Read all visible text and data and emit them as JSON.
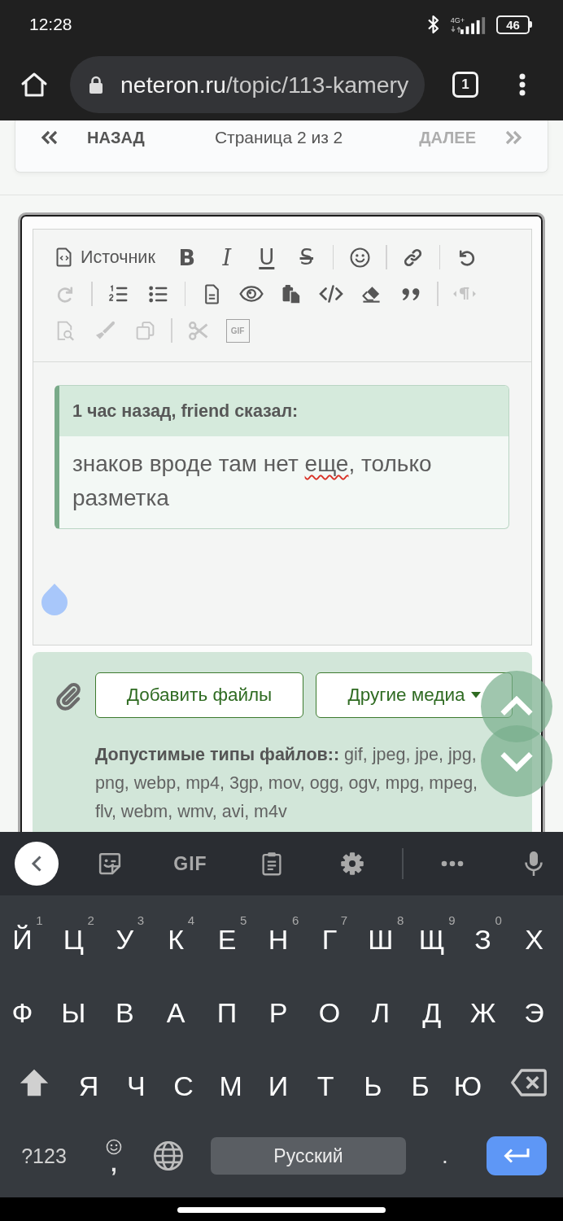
{
  "status_bar": {
    "time": "12:28",
    "network": "4G+",
    "battery": "46"
  },
  "browser": {
    "url_host": "neteron.ru",
    "url_path": "/topic/113-kamery",
    "tab_count": "1"
  },
  "pagination": {
    "prev": {
      "label": "НАЗАД",
      "disabled": false
    },
    "page": "Страница 2 из 2",
    "next": {
      "label": "ДАЛЕЕ",
      "disabled": true
    }
  },
  "editor": {
    "toolbar": [
      {
        "kind": "source",
        "label": "Источник",
        "disabled": false
      },
      {
        "kind": "bold",
        "label": "B",
        "disabled": false
      },
      {
        "kind": "italic",
        "label": "I",
        "disabled": false
      },
      {
        "kind": "underline",
        "label": "U",
        "disabled": false
      },
      {
        "kind": "strike",
        "label": "S",
        "disabled": false
      },
      {
        "kind": "separator"
      },
      {
        "kind": "emoji",
        "disabled": false
      },
      {
        "kind": "separator"
      },
      {
        "kind": "link",
        "disabled": false
      },
      {
        "kind": "separator"
      },
      {
        "kind": "undo",
        "disabled": false
      },
      {
        "kind": "redo",
        "disabled": true
      },
      {
        "kind": "separator"
      },
      {
        "kind": "numbered_list",
        "disabled": false
      },
      {
        "kind": "bullet_list",
        "disabled": false
      },
      {
        "kind": "separator"
      },
      {
        "kind": "document",
        "disabled": false
      },
      {
        "kind": "preview",
        "disabled": false
      },
      {
        "kind": "paste",
        "disabled": false
      },
      {
        "kind": "code",
        "disabled": false
      },
      {
        "kind": "eraser",
        "disabled": false
      },
      {
        "kind": "quote",
        "disabled": false
      },
      {
        "kind": "separator"
      },
      {
        "kind": "text_direction",
        "disabled": true
      },
      {
        "kind": "find",
        "disabled": true
      },
      {
        "kind": "brush",
        "disabled": true
      },
      {
        "kind": "copy",
        "disabled": true
      },
      {
        "kind": "separator"
      },
      {
        "kind": "cut",
        "disabled": true
      },
      {
        "kind": "gif",
        "label": "GIF",
        "disabled": true
      }
    ],
    "quote": {
      "header": "1 час назад, friend сказал:",
      "body": [
        {
          "text": "знаков вроде там нет ",
          "misspelled": false
        },
        {
          "text": "еще",
          "misspelled": true
        },
        {
          "text": ", только разметка",
          "misspelled": false
        }
      ]
    }
  },
  "attachments": {
    "buttons": [
      {
        "label": "Добавить файлы",
        "dropdown": false
      },
      {
        "label": "Другие медиа",
        "dropdown": true
      }
    ],
    "allowed_types": "**Допустимые типы файлов::** gif, jpeg, jpe, jpg, png, webp, mp4, 3gp, mov, ogg, ogv, mpg, mpeg, flv, webm, wmv, avi, m4v"
  },
  "keyboard": {
    "toolbar_gif": "GIF",
    "rows": [
      {
        "keys": [
          {
            "kind": "letter",
            "label": "Й",
            "hint": "1"
          },
          {
            "kind": "letter",
            "label": "Ц",
            "hint": "2"
          },
          {
            "kind": "letter",
            "label": "У",
            "hint": "3"
          },
          {
            "kind": "letter",
            "label": "К",
            "hint": "4"
          },
          {
            "kind": "letter",
            "label": "Е",
            "hint": "5"
          },
          {
            "kind": "letter",
            "label": "Н",
            "hint": "6"
          },
          {
            "kind": "letter",
            "label": "Г",
            "hint": "7"
          },
          {
            "kind": "letter",
            "label": "Ш",
            "hint": "8"
          },
          {
            "kind": "letter",
            "label": "Щ",
            "hint": "9"
          },
          {
            "kind": "letter",
            "label": "З",
            "hint": "0"
          },
          {
            "kind": "letter",
            "label": "Х"
          }
        ]
      },
      {
        "keys": [
          {
            "kind": "letter",
            "label": "Ф"
          },
          {
            "kind": "letter",
            "label": "Ы"
          },
          {
            "kind": "letter",
            "label": "В"
          },
          {
            "kind": "letter",
            "label": "А"
          },
          {
            "kind": "letter",
            "label": "П"
          },
          {
            "kind": "letter",
            "label": "Р"
          },
          {
            "kind": "letter",
            "label": "О"
          },
          {
            "kind": "letter",
            "label": "Л"
          },
          {
            "kind": "letter",
            "label": "Д"
          },
          {
            "kind": "letter",
            "label": "Ж"
          },
          {
            "kind": "letter",
            "label": "Э"
          }
        ]
      },
      {
        "keys": [
          {
            "kind": "shift"
          },
          {
            "kind": "letter",
            "label": "Я"
          },
          {
            "kind": "letter",
            "label": "Ч"
          },
          {
            "kind": "letter",
            "label": "С"
          },
          {
            "kind": "letter",
            "label": "М"
          },
          {
            "kind": "letter",
            "label": "И"
          },
          {
            "kind": "letter",
            "label": "Т"
          },
          {
            "kind": "letter",
            "label": "Ь"
          },
          {
            "kind": "letter",
            "label": "Б"
          },
          {
            "kind": "letter",
            "label": "Ю"
          },
          {
            "kind": "backspace"
          }
        ]
      },
      {
        "keys": [
          {
            "kind": "symbols",
            "label": "?123"
          },
          {
            "kind": "emoji_comma",
            "label": ","
          },
          {
            "kind": "language"
          },
          {
            "kind": "space",
            "label": "Русский"
          },
          {
            "kind": "period",
            "label": "."
          },
          {
            "kind": "enter"
          }
        ]
      }
    ]
  }
}
